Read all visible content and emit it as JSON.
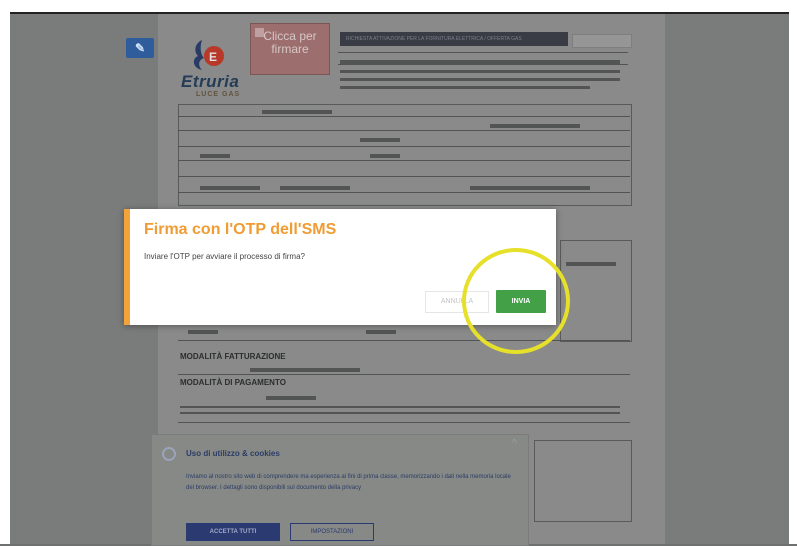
{
  "document": {
    "pdf_icon": "document-icon",
    "brand": {
      "name": "Etruria",
      "tagline": "LUCE GAS"
    },
    "sign_button": {
      "label": "Clicca per firmare"
    },
    "header_band": "RICHIESTA ATTIVAZIONE PER LA FORNITURA ELETTRICA / OFFERTA GAS",
    "sections": {
      "fatturazione": "MODALITÀ FATTURAZIONE",
      "pagamento": "MODALITÀ DI PAGAMENTO"
    }
  },
  "dialog": {
    "title": "Firma con l'OTP dell'SMS",
    "message": "Inviare l'OTP per avviare il processo di firma?",
    "cancel_label": "ANNULLA",
    "send_label": "INVIA"
  },
  "cookie_banner": {
    "title": "Uso di utilizzo & cookies",
    "text": "Inviamo al nostro sito web di comprendere ma esperienza ai fini di prima classe, memorizzando i dati nella memoria locale del browser. I dettagli sono disponibili sul documento della privacy",
    "accept_label": "ACCETTA TUTTI",
    "settings_label": "IMPOSTAZIONI"
  },
  "colors": {
    "dialog_accent": "#f2a43a",
    "send_button": "#43a047",
    "highlight_ring": "#e6e02b"
  }
}
